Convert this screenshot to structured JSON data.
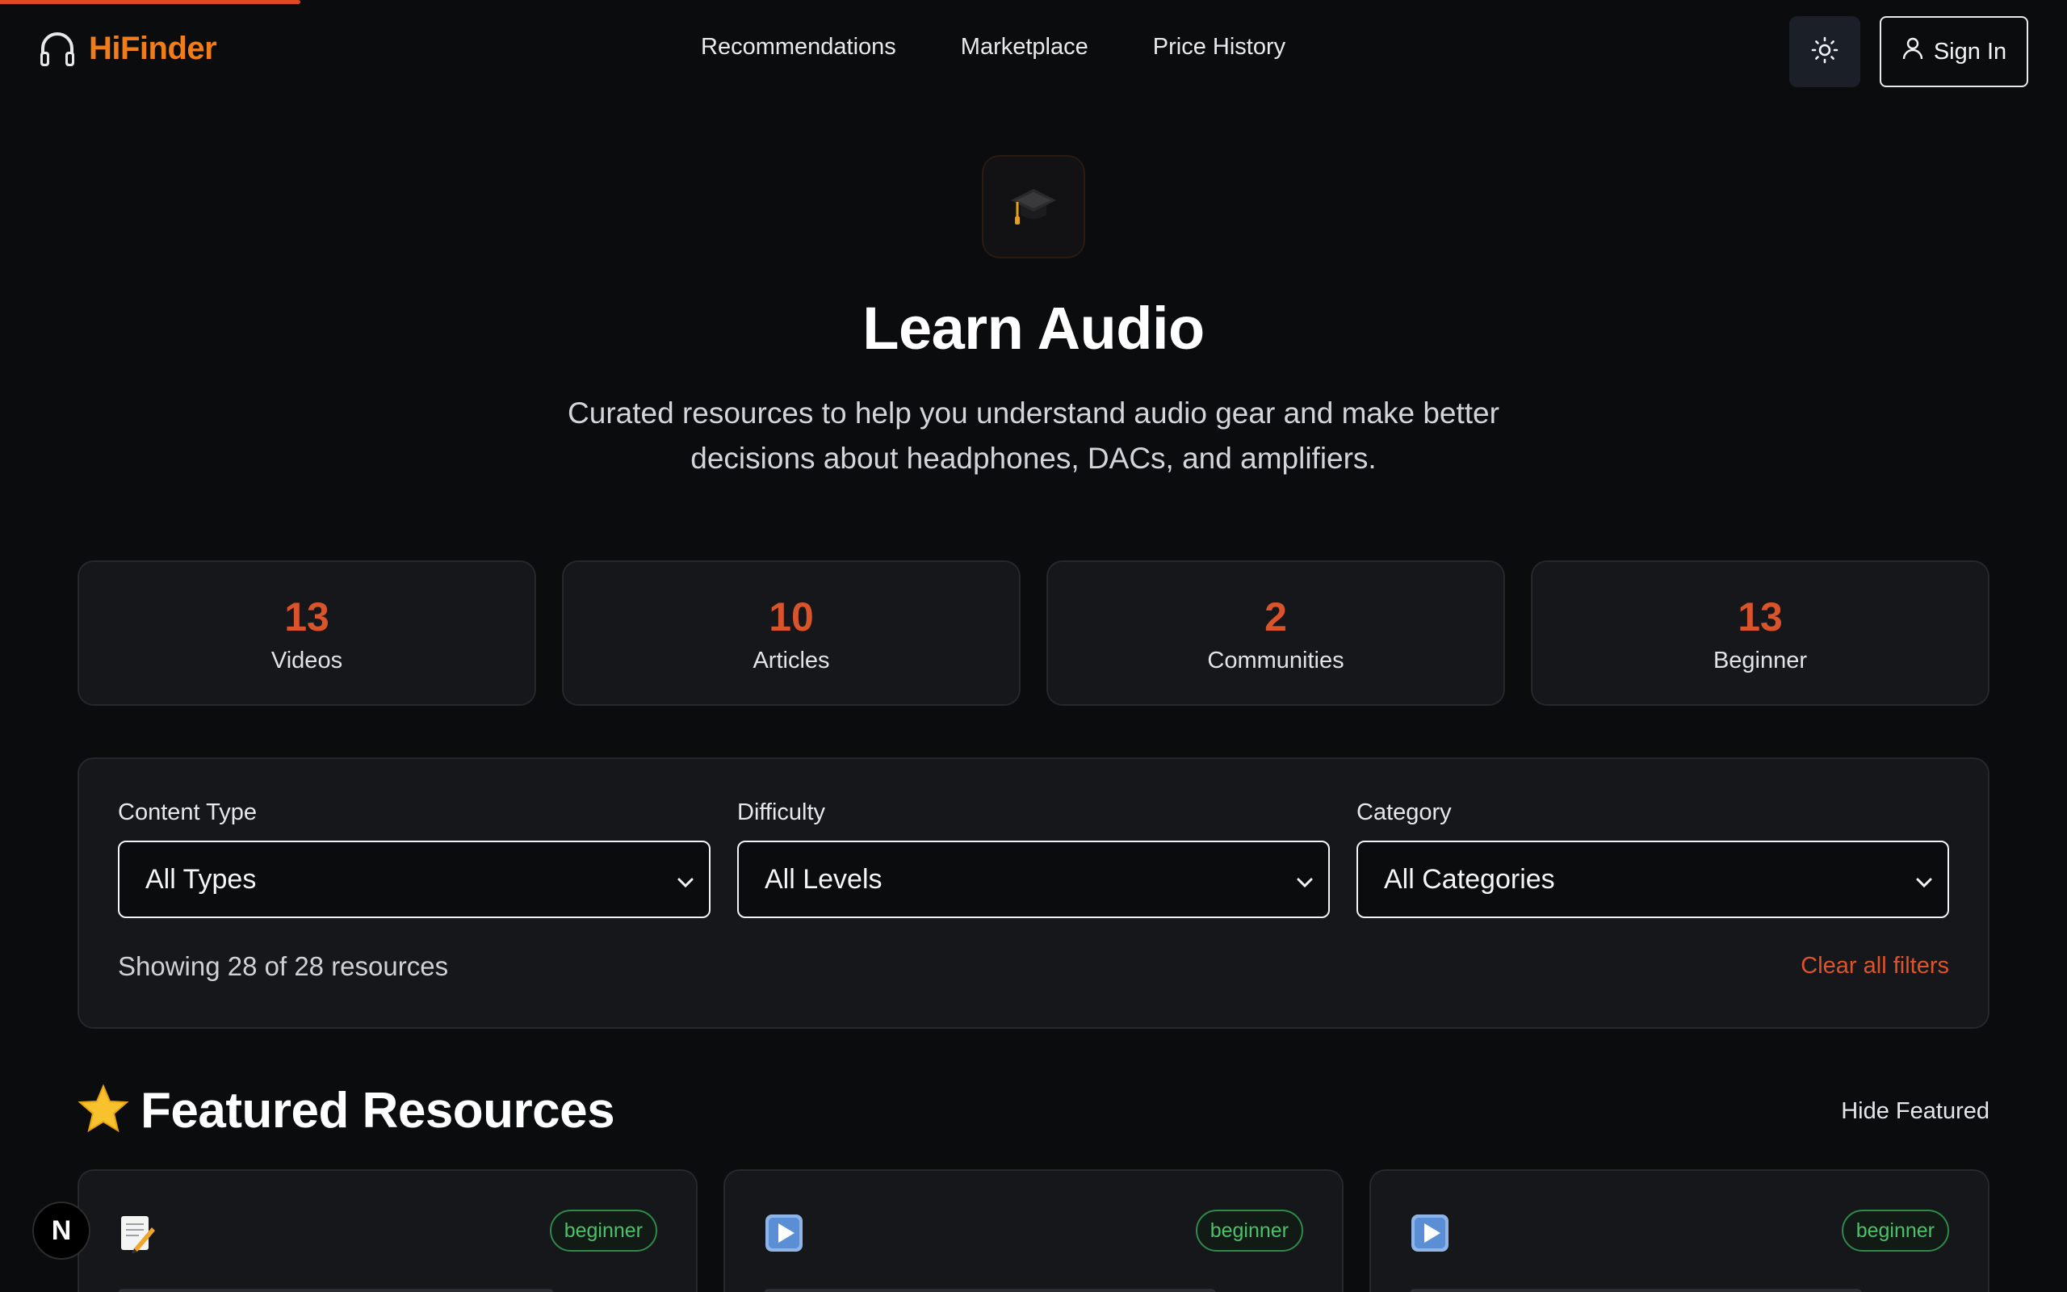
{
  "brand": {
    "name": "HiFinder",
    "accent": "#ef7d1a"
  },
  "nav": {
    "items": [
      "Recommendations",
      "Marketplace",
      "Price History"
    ]
  },
  "header": {
    "theme_icon": "sun-icon",
    "signin_label": "Sign In",
    "signin_icon": "user-icon"
  },
  "hero": {
    "icon": "graduation-cap-icon",
    "title": "Learn Audio",
    "subtitle": "Curated resources to help you understand audio gear and make better decisions about headphones, DACs, and amplifiers."
  },
  "stats": [
    {
      "value": "13",
      "label": "Videos"
    },
    {
      "value": "10",
      "label": "Articles"
    },
    {
      "value": "2",
      "label": "Communities"
    },
    {
      "value": "13",
      "label": "Beginner"
    }
  ],
  "filters": {
    "content_type": {
      "label": "Content Type",
      "value": "All Types"
    },
    "difficulty": {
      "label": "Difficulty",
      "value": "All Levels"
    },
    "category": {
      "label": "Category",
      "value": "All Categories"
    },
    "showing": "Showing 28 of 28 resources",
    "clear_label": "Clear all filters"
  },
  "featured": {
    "title": "Featured Resources",
    "hide_label": "Hide Featured",
    "cards": [
      {
        "icon": "memo-icon",
        "badge": "beginner"
      },
      {
        "icon": "play-button-icon",
        "badge": "beginner"
      },
      {
        "icon": "play-button-icon",
        "badge": "beginner"
      }
    ]
  },
  "devtools": {
    "label": "N"
  },
  "colors": {
    "background": "#0b0c0e",
    "card": "#16171b",
    "stat_number": "#d9542a",
    "badge_green": "#4cc06a"
  }
}
